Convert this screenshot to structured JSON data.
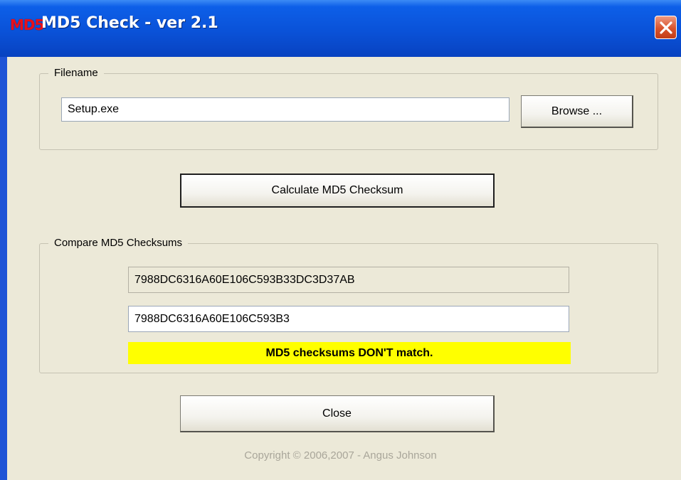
{
  "window": {
    "title": "MD5 Check - ver 2.1",
    "icon": "md5-app-icon",
    "icon_text": "MD5"
  },
  "filename": {
    "group_label": "Filename",
    "value": "Setup.exe",
    "browse_label": "Browse ..."
  },
  "calculate_label": "Calculate MD5 Checksum",
  "compare": {
    "group_label": "Compare MD5 Checksums",
    "computed": "7988DC6316A60E106C593B33DC3D37AB",
    "expected": "7988DC6316A60E106C593B3",
    "status": "MD5 checksums DON'T match.",
    "status_color": "#ffff00"
  },
  "close_label": "Close",
  "copyright": "Copyright © 2006,2007 - Angus Johnson"
}
